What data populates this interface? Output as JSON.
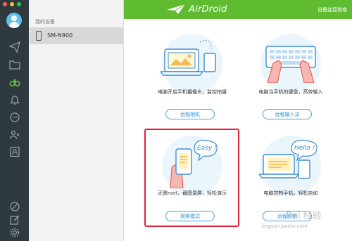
{
  "window": {
    "traffic_lights": [
      "#ff5f56",
      "#ffbd2e",
      "#27c93f"
    ]
  },
  "sidebar": {
    "icons": [
      "avatar-icon",
      "send-icon",
      "folder-icon",
      "binoculars-icon",
      "bell-icon",
      "chat-icon",
      "contacts-icon",
      "phone-book-icon",
      "help-icon",
      "edit-icon",
      "settings-icon"
    ]
  },
  "devices": {
    "section_label": "我的设备",
    "items": [
      {
        "name": "SM-N900"
      }
    ]
  },
  "header": {
    "app_name": "AirDroid",
    "guide_link": "设备连接指南",
    "bg_color": "#5fbc31"
  },
  "features": [
    {
      "desc": "电脑开启手机摄像头，监控拍摄",
      "button": "远程相机"
    },
    {
      "desc": "电脑当手机的键盘，高效输入",
      "button": "远程输入法"
    },
    {
      "desc": "无需root，截图录屏，轻松演示",
      "button": "观察模式",
      "bubble": "Easy !"
    },
    {
      "desc": "电脑控制手机，轻松自如",
      "button": "远程控制",
      "bubble": "Hello !"
    }
  ],
  "highlight_color": "#e2213b",
  "watermark": {
    "main": "Bai 经验",
    "sub": "jingyan.baidu.com"
  }
}
